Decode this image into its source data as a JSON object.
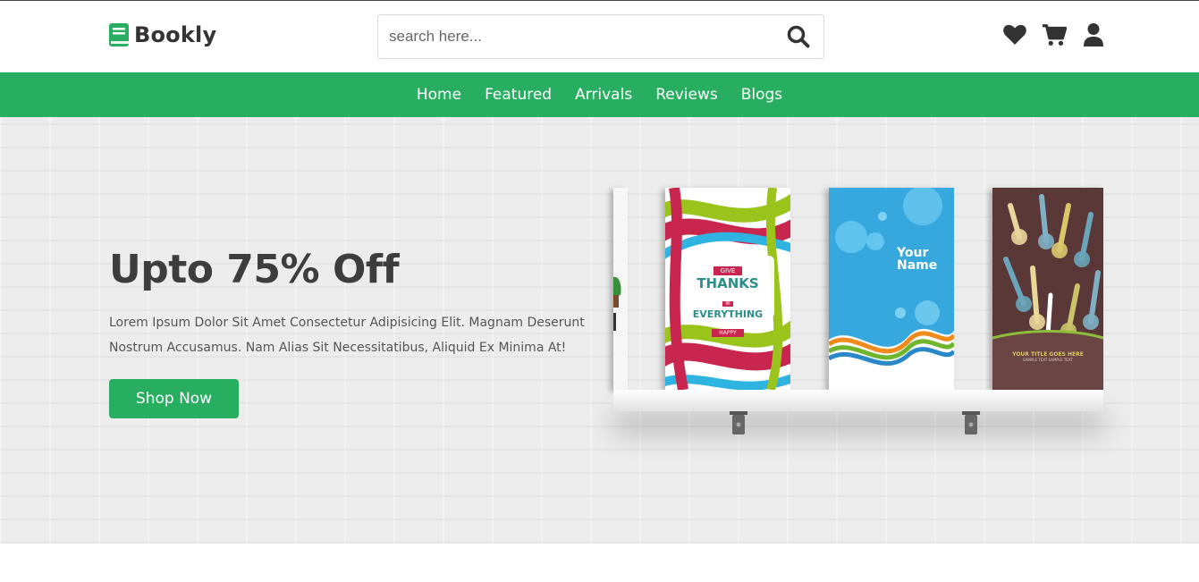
{
  "brand": {
    "name": "Bookly",
    "color": "#27ae60"
  },
  "search": {
    "placeholder": "search here...",
    "icon": "search-icon"
  },
  "header_icons": [
    "heart-icon",
    "cart-icon",
    "user-icon"
  ],
  "nav": {
    "links": [
      "Home",
      "Featured",
      "Arrivals",
      "Reviews",
      "Blogs"
    ]
  },
  "hero": {
    "title": "Upto 75% Off",
    "description": "Lorem Ipsum Dolor Sit Amet Consectetur Adipisicing Elit. Magnam Deserunt Nostrum Accusamus. Nam Alias Sit Necessitatibus, Aliquid Ex Minima At!",
    "button": "Shop Now"
  },
  "books": [
    {
      "cover_text": [
        "GIVE",
        "THANKS",
        "IN",
        "EVERYTHING",
        "HAPPY"
      ]
    },
    {
      "cover_text": [
        "Your",
        "Name"
      ]
    },
    {
      "cover_text": [
        "YOUR TITLE GOES HERE",
        "SAMPLE TEXT SAMPLE TEXT"
      ]
    }
  ]
}
